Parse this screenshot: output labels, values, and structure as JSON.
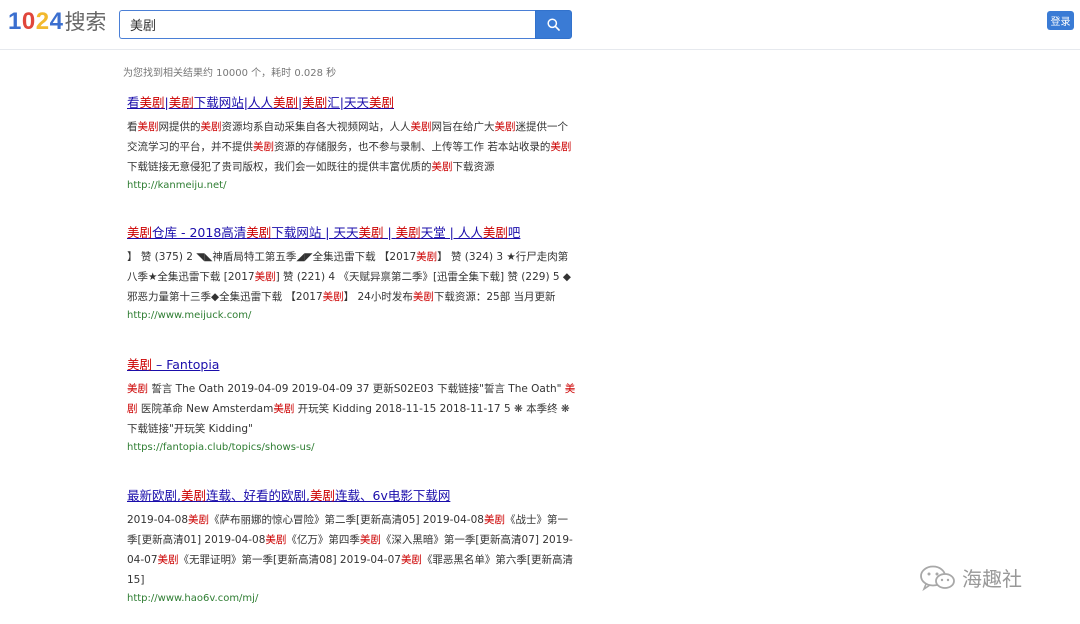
{
  "header": {
    "logo": {
      "digits": [
        {
          "char": "1",
          "color": "#3b6fcf"
        },
        {
          "char": "0",
          "color": "#e0463b"
        },
        {
          "char": "2",
          "color": "#f2b92e"
        },
        {
          "char": "4",
          "color": "#3b6fcf"
        }
      ],
      "suffix": "搜索"
    },
    "search": {
      "value": "美剧",
      "button_icon": "search-icon"
    },
    "login_label": "登录"
  },
  "stats": "为您找到相关结果约 10000 个，耗时 0.028 秒",
  "highlight_term": "美剧",
  "results": [
    {
      "title": "看美剧|美剧下载网站|人人美剧|美剧汇|天天美剧",
      "snippet": "看美剧网提供的美剧资源均系自动采集自各大视频网站，人人美剧网旨在给广大美剧迷提供一个交流学习的平台，并不提供美剧资源的存储服务，也不参与录制、上传等工作 若本站收录的美剧下载链接无意侵犯了贵司版权，我们会一如既往的提供丰富优质的美剧下载资源",
      "url": "http://kanmeiju.net/"
    },
    {
      "title": "美剧仓库 - 2018高清美剧下载网站 | 天天美剧 | 美剧天堂 | 人人美剧吧",
      "snippet": "】 赞 (375) 2 ◥◣神盾局特工第五季◢◤全集迅雷下载 【2017美剧】 赞 (324) 3 ★行尸走肉第八季★全集迅雷下载 [2017美剧] 赞 (221) 4 《天赋异禀第二季》[迅雷全集下载] 赞 (229) 5 ◆邪恶力量第十三季◆全集迅雷下载 【2017美剧】 24小时发布美剧下载资源：25部 当月更新",
      "url": "http://www.meijuck.com/"
    },
    {
      "title": "美剧 – Fantopia",
      "snippet": "美剧 誓言 The Oath 2019-04-09 2019-04-09 37 更新S02E03 下载链接\"誓言 The Oath\" 美剧 医院革命 New Amsterdam美剧 开玩笑 Kidding 2018-11-15 2018-11-17 5 ❋ 本季终 ❋ 下载链接\"开玩笑 Kidding\"",
      "url": "https://fantopia.club/topics/shows-us/"
    },
    {
      "title": "最新欧剧,美剧连载、好看的欧剧,美剧连载、6v电影下载网",
      "snippet": "2019-04-08美剧《萨布丽娜的惊心冒险》第二季[更新高清05] 2019-04-08美剧《战士》第一季[更新高清01] 2019-04-08美剧《亿万》第四季美剧《深入黑暗》第一季[更新高清07] 2019-04-07美剧《无罪证明》第一季[更新高清08] 2019-04-07美剧《罪恶黑名单》第六季[更新高清15]",
      "url": "http://www.hao6v.com/mj/"
    }
  ],
  "watermark": {
    "icon": "wechat-icon",
    "text": "海趣社"
  }
}
